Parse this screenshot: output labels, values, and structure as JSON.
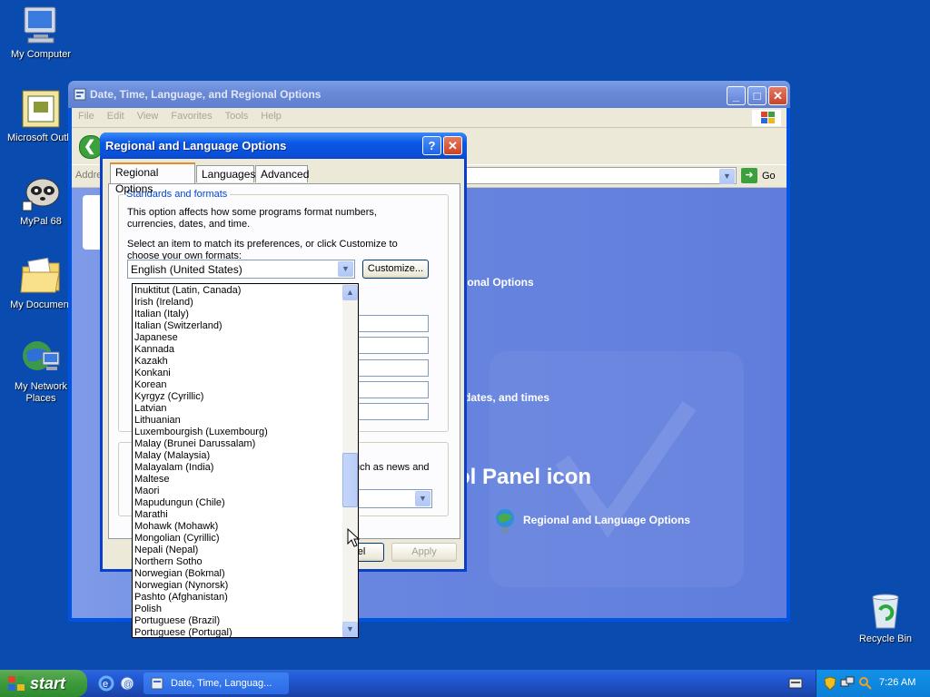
{
  "desktop": {
    "icons": [
      {
        "label": "My Computer"
      },
      {
        "label": "Microsoft Outlo"
      },
      {
        "label": "MyPal 68"
      },
      {
        "label": "My Document"
      },
      {
        "label": "My Network Places"
      },
      {
        "label": "Recycle Bin"
      }
    ]
  },
  "explorer": {
    "title": "Date, Time, Language, and Regional Options",
    "menu": [
      "File",
      "Edit",
      "View",
      "Favorites",
      "Tools",
      "Help"
    ],
    "address_label": "Addre",
    "go_label": "Go",
    "content": {
      "heading_partial": "ional Options",
      "task_partial": "dates, and times",
      "section_partial": "ol Panel icon",
      "link_label": "Regional and Language Options"
    }
  },
  "dialog": {
    "title": "Regional and Language Options",
    "tabs": [
      "Regional Options",
      "Languages",
      "Advanced"
    ],
    "group_label": "Standards and formats",
    "desc1": "This option affects how some programs format numbers, currencies, dates, and time.",
    "desc2": "Select an item to match its preferences, or click Customize to choose your own formats:",
    "selected_format": "English (United States)",
    "customize_label": "Customize...",
    "location_partial": "uch as news and",
    "cancel_partial": "el",
    "apply_label": "Apply"
  },
  "dropdown": {
    "items": [
      "Inuktitut (Latin, Canada)",
      "Irish (Ireland)",
      "Italian (Italy)",
      "Italian (Switzerland)",
      "Japanese",
      "Kannada",
      "Kazakh",
      "Konkani",
      "Korean",
      "Kyrgyz (Cyrillic)",
      "Latvian",
      "Lithuanian",
      "Luxembourgish (Luxembourg)",
      "Malay (Brunei Darussalam)",
      "Malay (Malaysia)",
      "Malayalam (India)",
      "Maltese",
      "Maori",
      "Mapudungun (Chile)",
      "Marathi",
      "Mohawk (Mohawk)",
      "Mongolian (Cyrillic)",
      "Nepali (Nepal)",
      "Northern Sotho",
      "Norwegian (Bokmal)",
      "Norwegian (Nynorsk)",
      "Pashto (Afghanistan)",
      "Polish",
      "Portuguese (Brazil)",
      "Portuguese (Portugal)"
    ]
  },
  "taskbar": {
    "start_label": "start",
    "task_label": "Date, Time, Languag...",
    "clock": "7:26 AM"
  },
  "colors": {
    "desktop": "#0a4bb0",
    "dialog_title": "#0958e5",
    "group_label": "#0046d5"
  }
}
